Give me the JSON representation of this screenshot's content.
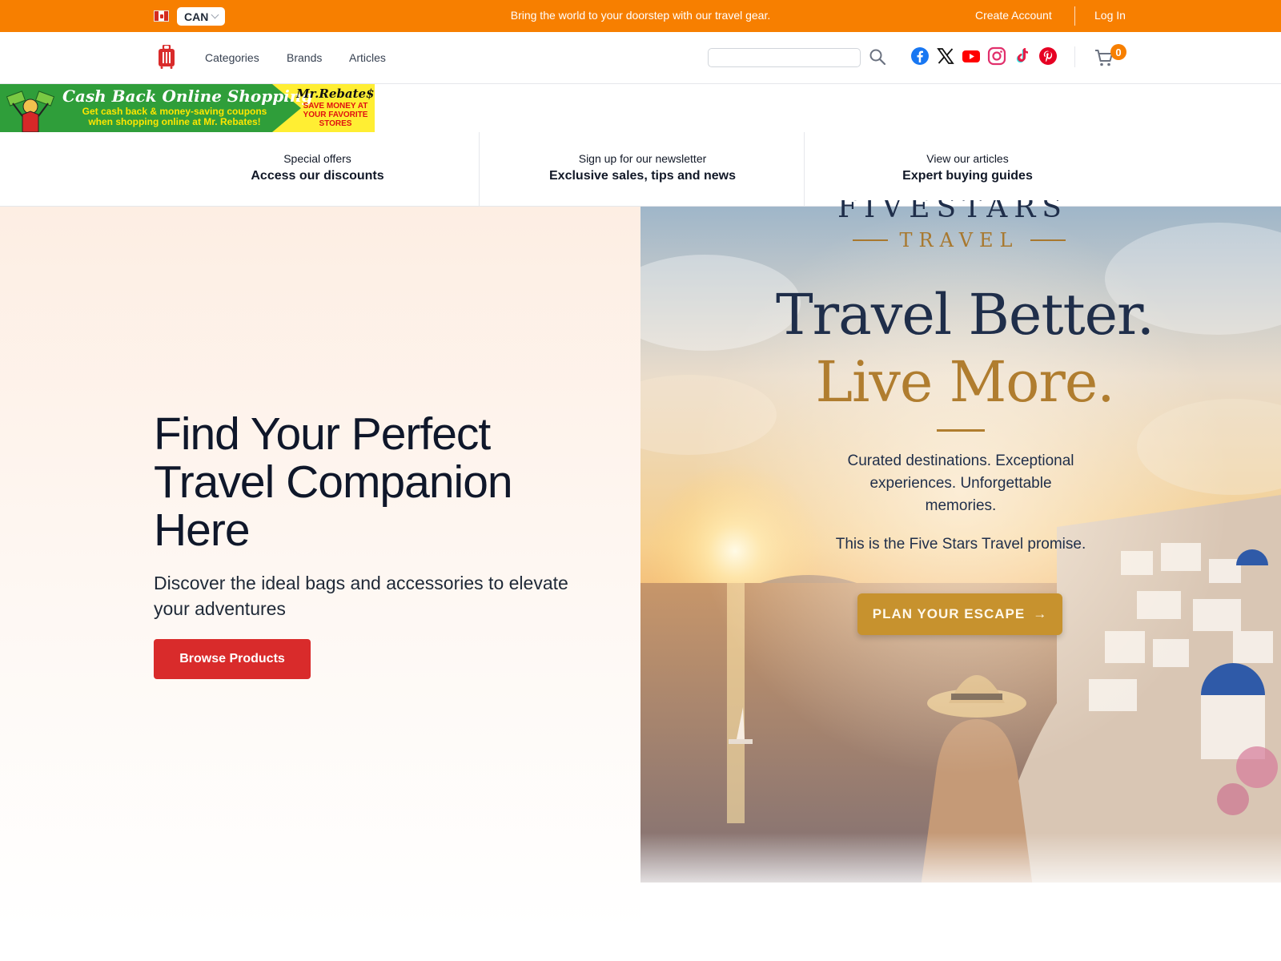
{
  "topbar": {
    "country": "CAN",
    "promo": "Bring the world to your doorstep with our travel gear.",
    "create_account": "Create Account",
    "login": "Log In"
  },
  "nav": {
    "links": [
      "Categories",
      "Brands",
      "Articles"
    ],
    "search_placeholder": "",
    "cart_count": "0",
    "social_icons": [
      "facebook-icon",
      "x-icon",
      "youtube-icon",
      "instagram-icon",
      "tiktok-icon",
      "pinterest-icon"
    ]
  },
  "ad_banner": {
    "title": "Cash Back Online Shopping",
    "subtitle": "Get cash back & money-saving coupons when shopping online at Mr. Rebates!",
    "brand": "Mr.Rebate$",
    "brand_sub": "SAVE MONEY AT YOUR FAVORITE STORES"
  },
  "features": [
    {
      "kicker": "Special offers",
      "title": "Access our discounts"
    },
    {
      "kicker": "Sign up for our newsletter",
      "title": "Exclusive sales, tips and news"
    },
    {
      "kicker": "View our articles",
      "title": "Expert buying guides"
    }
  ],
  "hero": {
    "title": "Find Your Perfect Travel Companion Here",
    "subtitle": "Discover the ideal bags and accessories to elevate your adventures",
    "button": "Browse Products"
  },
  "hero_ad": {
    "logo": "FIVESTARS",
    "logo_sub": "TRAVEL",
    "headline1": "Travel Better.",
    "headline2": "Live More.",
    "copy1": "Curated destinations. Exceptional experiences. Unforgettable memories.",
    "copy2": "This is the Five Stars Travel promise.",
    "cta": "PLAN YOUR ESCAPE"
  },
  "colors": {
    "topbar": "#f77f00",
    "primary_button": "#d92b2b",
    "cart_badge": "#f77f00"
  }
}
